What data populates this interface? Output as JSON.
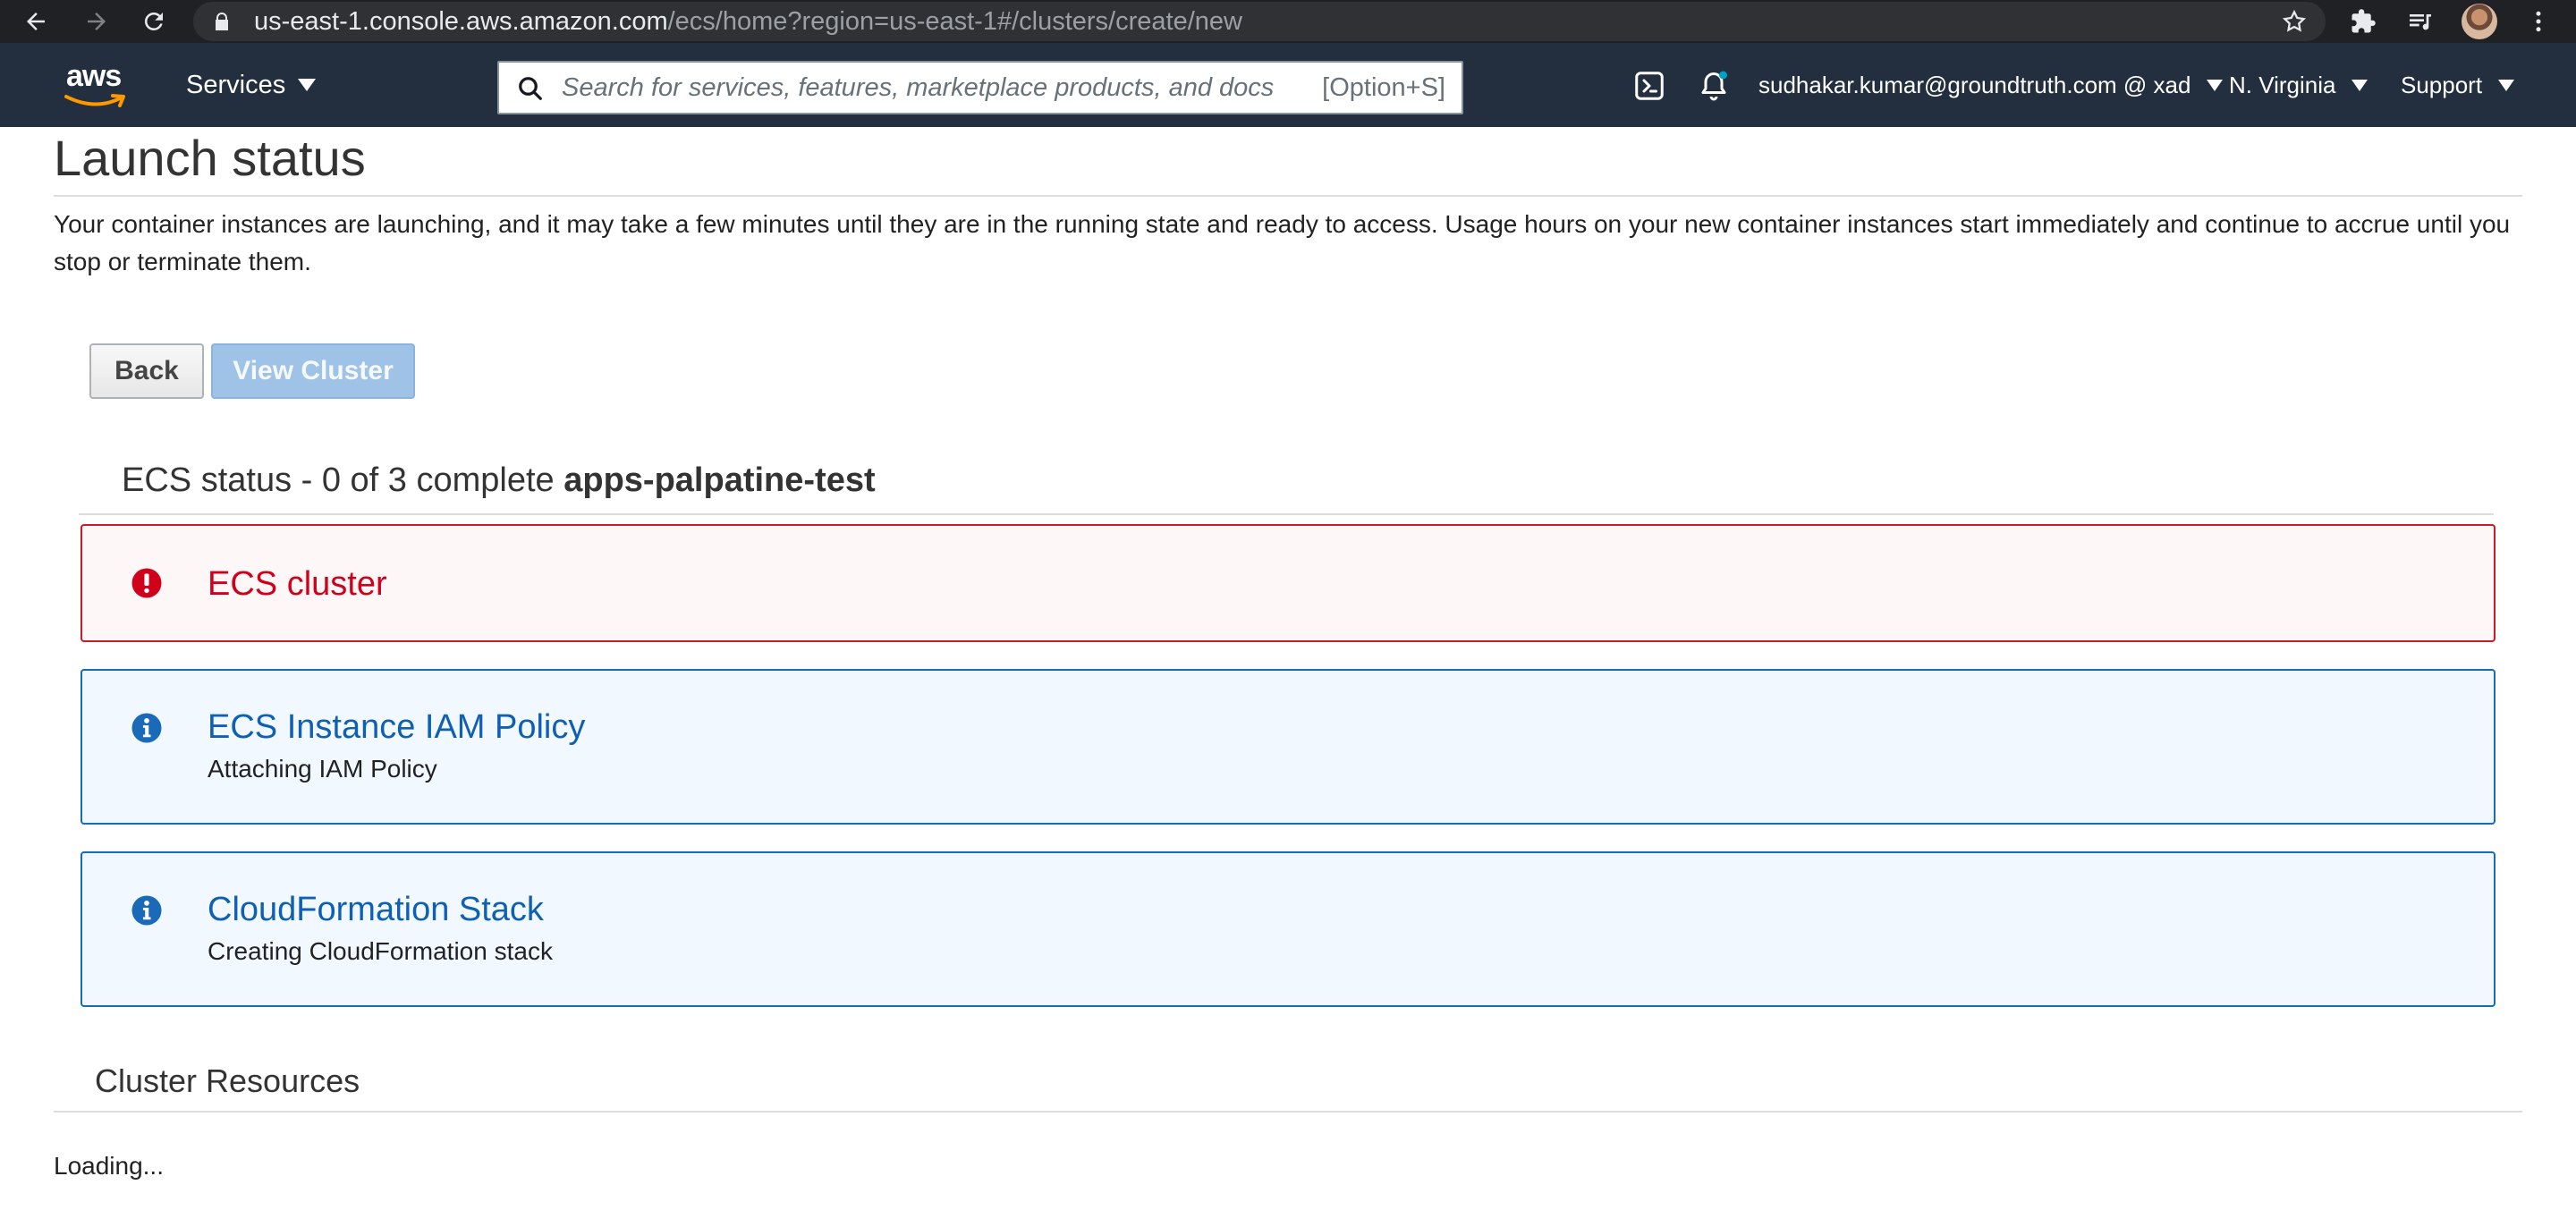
{
  "browser": {
    "url_host": "us-east-1.console.aws.amazon.com",
    "url_path": "/ecs/home?region=us-east-1#/clusters/create/new"
  },
  "header": {
    "logo_text": "aws",
    "services_label": "Services",
    "search_placeholder": "Search for services, features, marketplace products, and docs",
    "search_shortcut": "[Option+S]",
    "account": "sudhakar.kumar@groundtruth.com @ xad",
    "region": "N. Virginia",
    "support": "Support"
  },
  "page": {
    "title": "Launch status",
    "intro": "Your container instances are launching, and it may take a few minutes until they are in the running state and ready to access. Usage hours on your new container instances start immediately and continue to accrue until you stop or terminate them.",
    "back_label": "Back",
    "view_cluster_label": "View Cluster",
    "status_prefix": "ECS status - 0 of 3 complete",
    "cluster_name": "apps-palpatine-test",
    "steps": [
      {
        "title": "ECS cluster",
        "subtitle": "",
        "state": "error"
      },
      {
        "title": "ECS Instance IAM Policy",
        "subtitle": "Attaching IAM Policy",
        "state": "info"
      },
      {
        "title": "CloudFormation Stack",
        "subtitle": "Creating CloudFormation stack",
        "state": "info"
      }
    ],
    "resources_title": "Cluster Resources",
    "loading_text": "Loading..."
  },
  "colors": {
    "aws_header": "#232f3e",
    "error": "#d0021b",
    "info": "#0f5fb3",
    "button_primary_disabled": "#9fc3e6"
  }
}
